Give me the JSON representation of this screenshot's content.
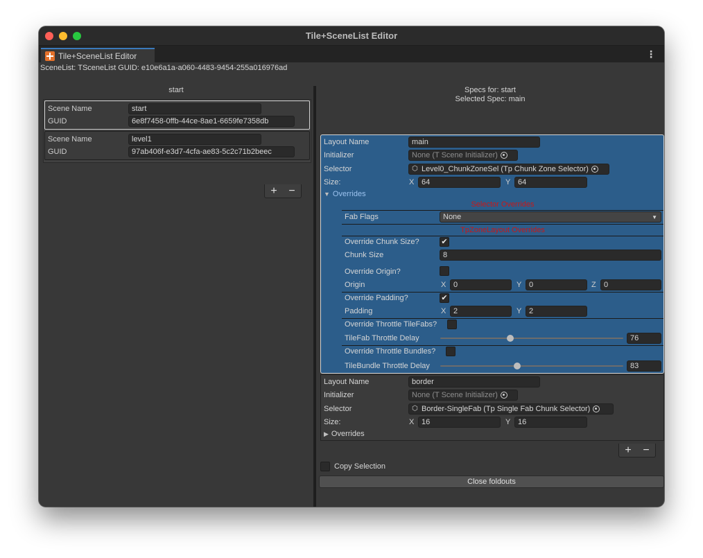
{
  "window": {
    "title": "Tile+SceneList Editor"
  },
  "tab": {
    "label": "Tile+SceneList Editor",
    "icon": "tile-plus-icon"
  },
  "header": {
    "scenelist_guid": "SceneList:  TSceneList GUID: e10e6a1a-a060-4483-9454-255a016976ad"
  },
  "left": {
    "title": "start",
    "scenes": [
      {
        "name_label": "Scene Name",
        "name": "start",
        "guid_label": "GUID",
        "guid": "6e8f7458-0ffb-44ce-8ae1-6659fe7358db"
      },
      {
        "name_label": "Scene Name",
        "name": "level1",
        "guid_label": "GUID",
        "guid": "97ab406f-e3d7-4cfa-ae83-5c2c71b2beec"
      }
    ],
    "add": "+",
    "remove": "−"
  },
  "right": {
    "specs_for": "Specs for: start",
    "selected_spec": "Selected Spec: main",
    "spec1": {
      "layout_name_label": "Layout Name",
      "layout_name": "main",
      "initializer_label": "Initializer",
      "initializer": "None (T Scene Initializer)",
      "selector_label": "Selector",
      "selector": "Level0_ChunkZoneSel (Tp Chunk Zone Selector)",
      "size_label": "Size:",
      "size_x": "64",
      "size_y": "64",
      "overrides_label": "Overrides",
      "selector_overrides": "Selector Overrides",
      "fab_flags_label": "Fab Flags",
      "fab_flags": "None",
      "zone_overrides": "TpZoneLayout Overrides",
      "override_chunk_size_label": "Override Chunk Size?",
      "chunk_size_label": "Chunk Size",
      "chunk_size": "8",
      "override_origin_label": "Override Origin?",
      "origin_label": "Origin",
      "origin_x": "0",
      "origin_y": "0",
      "origin_z": "0",
      "override_padding_label": "Override Padding?",
      "padding_label": "Padding",
      "padding_x": "2",
      "padding_y": "2",
      "override_throttle_tilefabs_label": "Override Throttle TileFabs?",
      "tilefab_delay_label": "TileFab Throttle Delay",
      "tilefab_delay": "76",
      "override_throttle_bundles_label": "Override Throttle Bundles?",
      "tilebundle_delay_label": "TileBundle Throttle Delay",
      "tilebundle_delay": "83"
    },
    "spec2": {
      "layout_name_label": "Layout Name",
      "layout_name": "border",
      "initializer_label": "Initializer",
      "initializer": "None (T Scene Initializer)",
      "selector_label": "Selector",
      "selector": "Border-SingleFab (Tp Single Fab Chunk Selector)",
      "size_label": "Size:",
      "size_x": "16",
      "size_y": "16",
      "overrides_label": "Overrides"
    },
    "axis_x": "X",
    "axis_y": "Y",
    "axis_z": "Z",
    "add": "+",
    "remove": "−",
    "copy_selection_label": "Copy Selection",
    "close_foldouts_label": "Close foldouts"
  }
}
